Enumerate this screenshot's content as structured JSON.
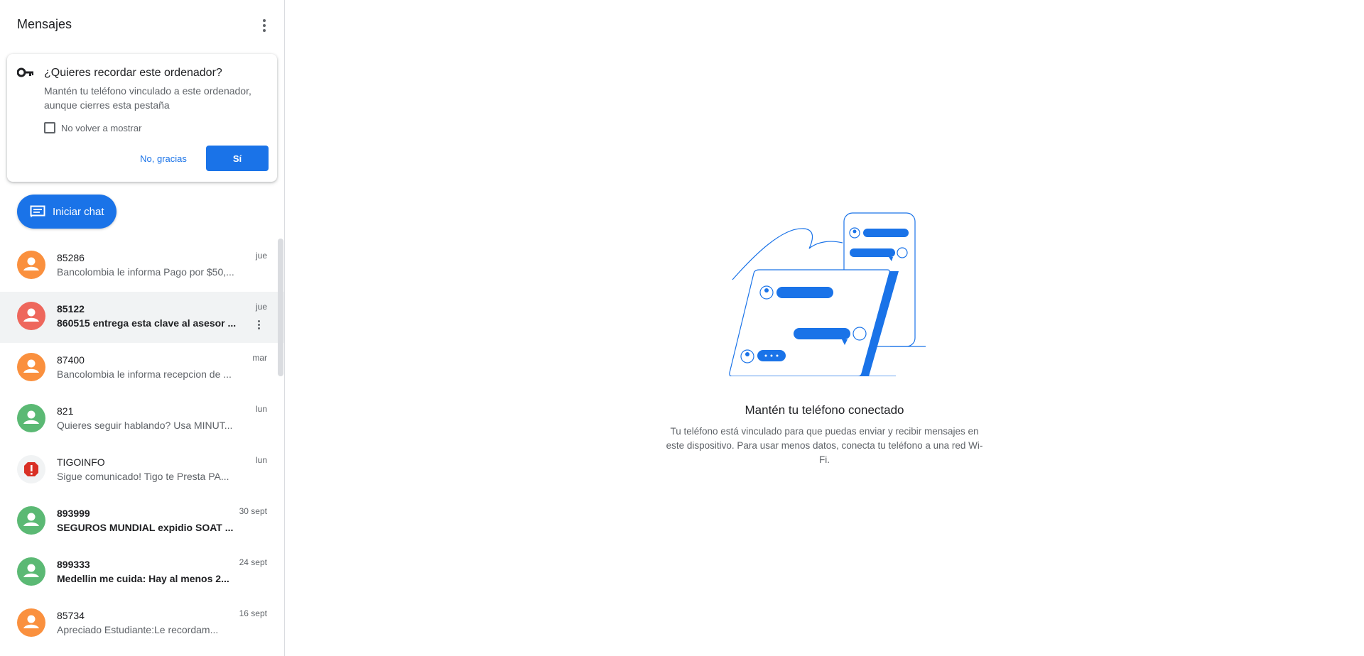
{
  "sidebar": {
    "title": "Mensajes",
    "promo": {
      "title": "¿Quieres recordar este ordenador?",
      "body": "Mantén tu teléfono vinculado a este ordenador, aunque cierres esta pestaña",
      "checkbox_label": "No volver a mostrar",
      "no_label": "No, gracias",
      "yes_label": "Sí"
    },
    "start_chat_label": "Iniciar chat",
    "conversations": [
      {
        "name": "85286",
        "snippet": "Bancolombia le informa Pago por $50,...",
        "time": "jue",
        "avatar_color": "#fa903e",
        "unread": false
      },
      {
        "name": "85122",
        "snippet": "860515 entrega esta clave al asesor ...",
        "time": "jue",
        "avatar_color": "#ee675c",
        "unread": true
      },
      {
        "name": "87400",
        "snippet": "Bancolombia le informa recepcion de ...",
        "time": "mar",
        "avatar_color": "#fa903e",
        "unread": false
      },
      {
        "name": "821",
        "snippet": "Quieres seguir hablando? Usa MINUT...",
        "time": "lun",
        "avatar_color": "#5bb974",
        "unread": false
      },
      {
        "name": "TIGOINFO",
        "snippet": "Sigue comunicado! Tigo te Presta PA...",
        "time": "lun",
        "avatar_color": "#d93025",
        "unread": false
      },
      {
        "name": "893999",
        "snippet": "SEGUROS MUNDIAL expidio SOAT ...",
        "time": "30 sept",
        "avatar_color": "#5bb974",
        "unread": true
      },
      {
        "name": "899333",
        "snippet": "Medellin me cuida: Hay al menos 2...",
        "time": "24 sept",
        "avatar_color": "#5bb974",
        "unread": true
      },
      {
        "name": "85734",
        "snippet": "Apreciado Estudiante:Le recordam...",
        "time": "16 sept",
        "avatar_color": "#fa903e",
        "unread": false
      }
    ]
  },
  "main": {
    "title": "Mantén tu teléfono conectado",
    "description": "Tu teléfono está vinculado para que puedas enviar y recibir mensajes en este dispositivo. Para usar menos datos, conecta tu teléfono a una red Wi-Fi."
  },
  "colors": {
    "accent": "#1a73e8",
    "selected_row": "#f1f3f4"
  },
  "icons": {
    "menu": "more-vert-icon",
    "promo": "key-icon",
    "start_chat": "message-icon",
    "warning": "warning-octagon-icon"
  }
}
